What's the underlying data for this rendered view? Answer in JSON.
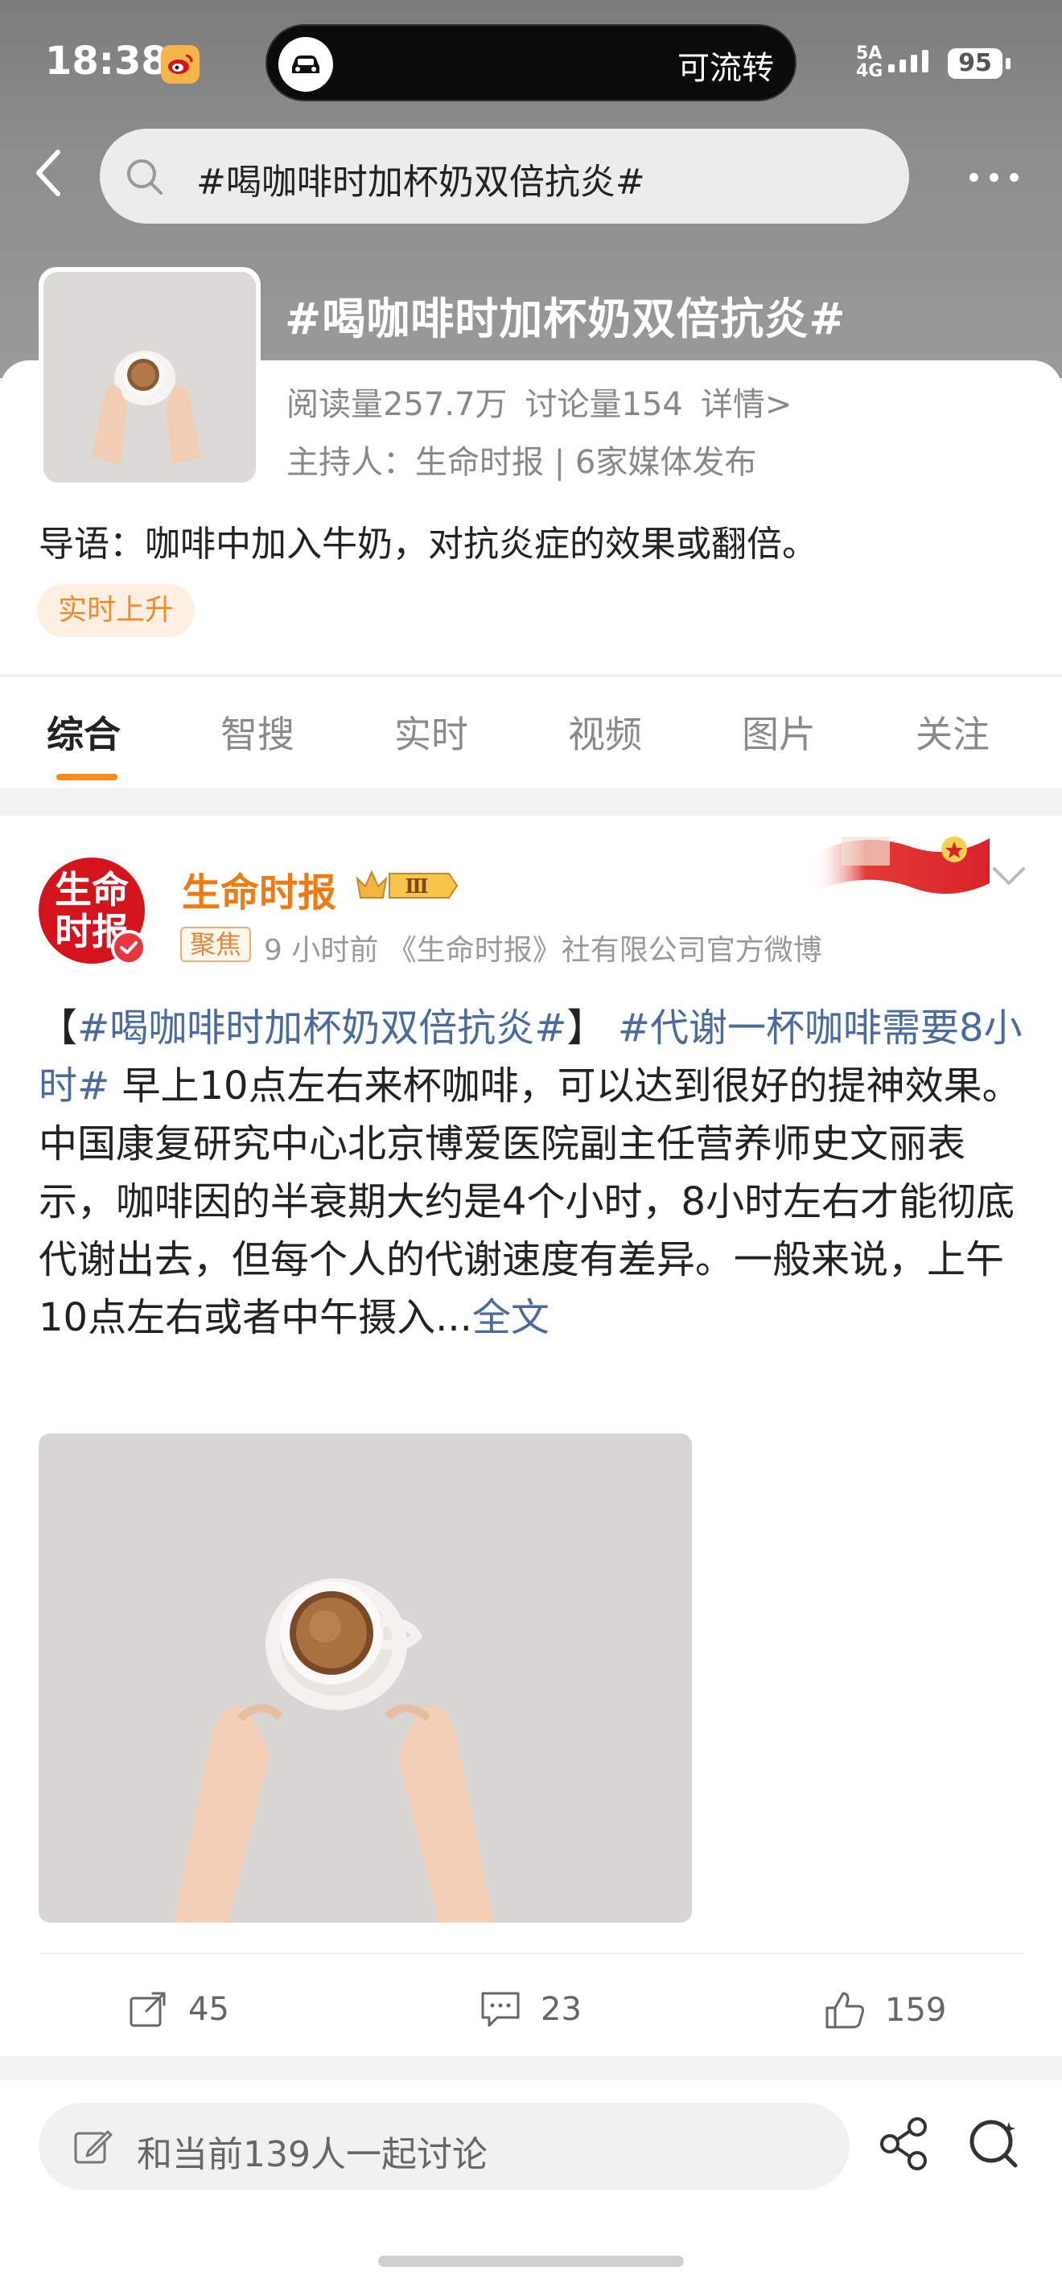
{
  "status_bar": {
    "time": "18:38",
    "island_label": "可流转",
    "network": "5A 4G",
    "battery": "95"
  },
  "nav": {
    "search_text": "#喝咖啡时加杯奶双倍抗炎#"
  },
  "topic": {
    "title": "#喝咖啡时加杯奶双倍抗炎#",
    "reads": "阅读量257.7万",
    "discussions": "讨论量154",
    "details": "详情>",
    "host": "主持人：生命时报 | 6家媒体发布",
    "guide": "导语：咖啡中加入牛奶，对抗炎症的效果或翻倍。",
    "badge": "实时上升"
  },
  "tabs": [
    {
      "label": "综合",
      "active": true
    },
    {
      "label": "智搜",
      "active": false
    },
    {
      "label": "实时",
      "active": false
    },
    {
      "label": "视频",
      "active": false
    },
    {
      "label": "图片",
      "active": false
    },
    {
      "label": "关注",
      "active": false
    }
  ],
  "post": {
    "avatar_text_line1": "生命",
    "avatar_text_line2": "时报",
    "author": "生命时报",
    "level_badge": "Ⅲ",
    "focus_tag": "聚焦",
    "meta": "9 小时前  《生命时报》社有限公司官方微博",
    "bracket_open": "【",
    "tag1": "#喝咖啡时加杯奶双倍抗炎#",
    "bracket_close": "】",
    "tag2": "#代谢一杯咖啡需要8小时#",
    "body": " 早上10点左右来杯咖啡，可以达到很好的提神效果。中国康复研究中心北京博爱医院副主任营养师史文丽表示，咖啡因的半衰期大约是4个小时，8小时左右才能彻底代谢出去，但每个人的代谢速度有差异。一般来说，上午10点左右或者中午摄入...",
    "full_text_link": "全文",
    "reposts": "45",
    "comments": "23",
    "likes": "159"
  },
  "bottom": {
    "discuss_placeholder": "和当前139人一起讨论"
  },
  "colors": {
    "accent_orange": "#f07a12",
    "tag_blue": "#4b6a9e",
    "tab_indicator": "#f98a1c"
  }
}
